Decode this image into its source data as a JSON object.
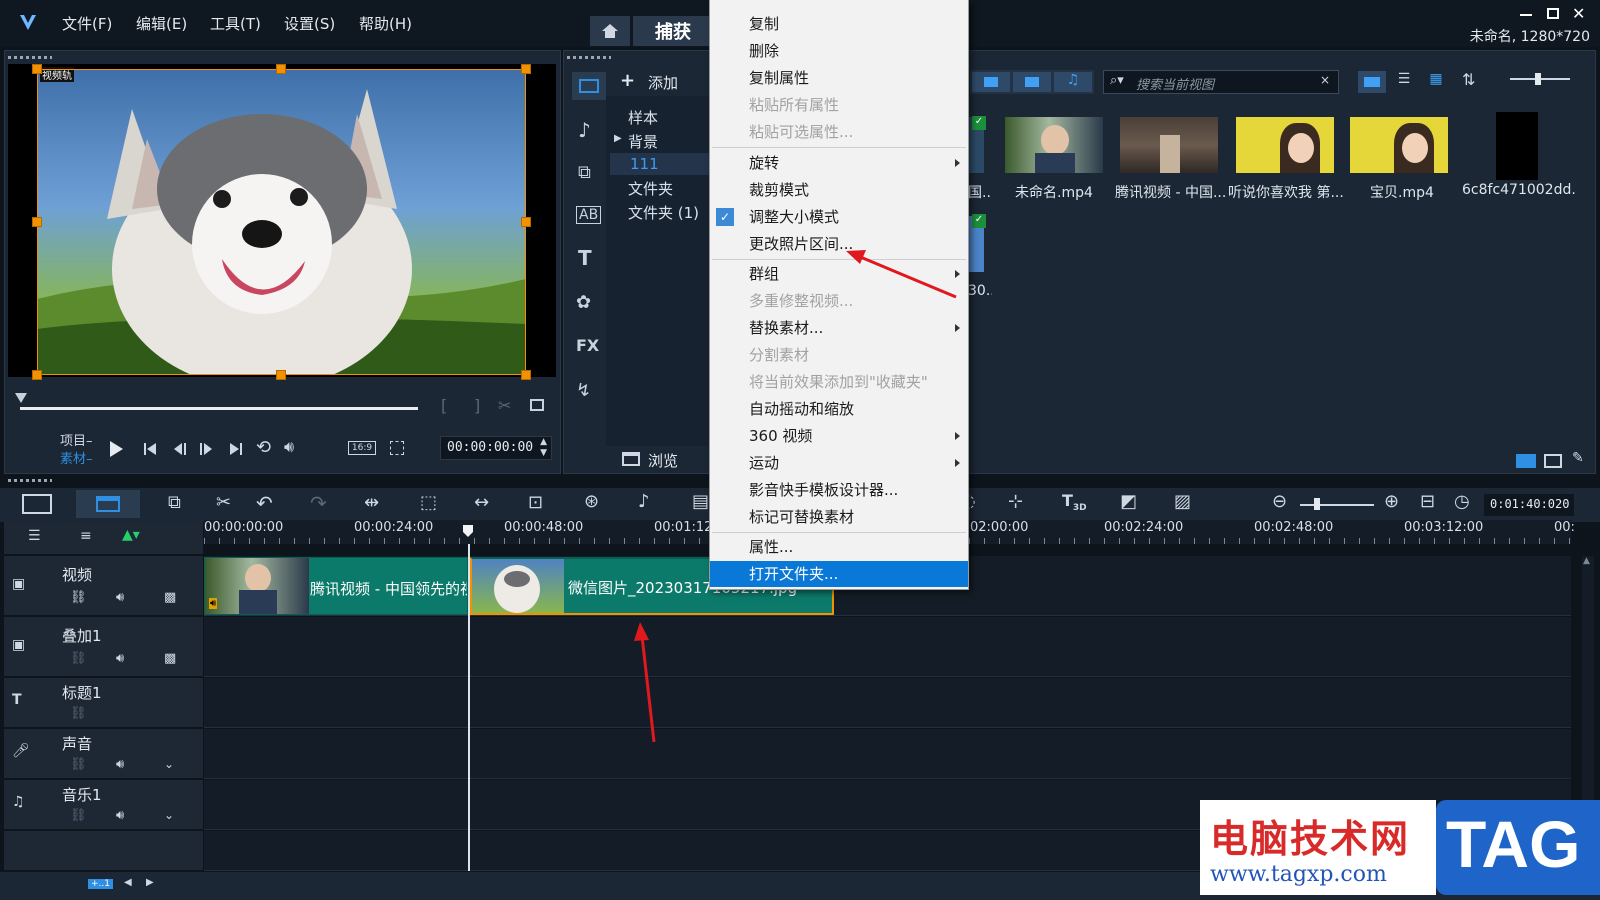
{
  "menubar": {
    "items": [
      "文件(F)",
      "编辑(E)",
      "工具(T)",
      "设置(S)",
      "帮助(H)"
    ],
    "capture_tab": "捕获"
  },
  "window": {
    "project_info": "未命名, 1280*720"
  },
  "preview": {
    "overlay_label": "视频轨",
    "project_label": "项目–",
    "clip_label": "素材–",
    "aspect": "16:9",
    "timecode": "00:00:00:00"
  },
  "library": {
    "add_label": "添加",
    "items": [
      "样本",
      "背景",
      "111",
      "文件夹",
      "文件夹 (1)"
    ],
    "browse_label": "浏览",
    "search_placeholder": "搜索当前视图"
  },
  "media": {
    "items": [
      {
        "caption": "未命名.mp4"
      },
      {
        "caption": "腾讯视频 - 中国..."
      },
      {
        "caption": "听说你喜欢我 第..."
      },
      {
        "caption": "宝贝.mp4"
      },
      {
        "caption": "6c8fc471002dd..."
      }
    ],
    "partial_caption_1": "国...",
    "partial_caption_2": "30..."
  },
  "context_menu": {
    "items": [
      {
        "label": "复制",
        "state": "normal"
      },
      {
        "label": "删除",
        "state": "normal"
      },
      {
        "label": "复制属性",
        "state": "normal"
      },
      {
        "label": "粘贴所有属性",
        "state": "disabled"
      },
      {
        "label": "粘贴可选属性...",
        "state": "disabled"
      },
      {
        "label": "旋转",
        "state": "submenu"
      },
      {
        "label": "裁剪模式",
        "state": "normal"
      },
      {
        "label": "调整大小模式",
        "state": "checked"
      },
      {
        "label": "更改照片区间...",
        "state": "normal"
      },
      {
        "label": "群组",
        "state": "submenu"
      },
      {
        "label": "多重修整视频...",
        "state": "disabled"
      },
      {
        "label": "替换素材...",
        "state": "submenu"
      },
      {
        "label": "分割素材",
        "state": "disabled"
      },
      {
        "label": "将当前效果添加到\"收藏夹\"",
        "state": "disabled"
      },
      {
        "label": "自动摇动和缩放",
        "state": "normal"
      },
      {
        "label": "360 视频",
        "state": "submenu"
      },
      {
        "label": "运动",
        "state": "submenu"
      },
      {
        "label": "影音快手模板设计器...",
        "state": "normal"
      },
      {
        "label": "标记可替换素材",
        "state": "normal"
      },
      {
        "label": "属性...",
        "state": "normal"
      },
      {
        "label": "打开文件夹...",
        "state": "selected"
      }
    ]
  },
  "timeline": {
    "duration": "0:01:40:020",
    "ruler": [
      "00:00:00:00",
      "00:00:24:00",
      "00:00:48:00",
      "00:01:12",
      "02:00:00",
      "00:02:24:00",
      "00:02:48:00",
      "00:03:12:00",
      "00:"
    ],
    "tracks": [
      "视频",
      "叠加1",
      "标题1",
      "声音",
      "音乐1"
    ],
    "clips": [
      {
        "label": "腾讯视频 - 中国领先的视"
      },
      {
        "label": "微信图片_20230317105217.jpg"
      }
    ],
    "bottom_label": "+..1"
  },
  "watermark": {
    "title": "电脑技术网",
    "url": "www.tagxp.com",
    "tag": "TAG"
  },
  "colors": {
    "accent": "#0a78d7",
    "clip": "#0c7a6b",
    "selection": "#f39200",
    "annotation": "#e0191e"
  }
}
